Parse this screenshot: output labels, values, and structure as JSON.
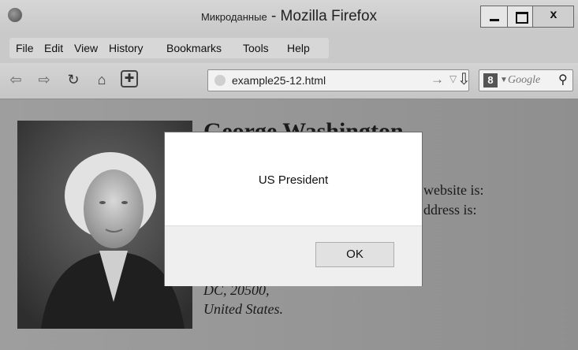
{
  "window": {
    "title_sub": "Микроданные",
    "title_main": "- Mozilla Firefox",
    "close_label": "x"
  },
  "menu": {
    "items": [
      "File",
      "Edit",
      "View",
      "History",
      "Bookmarks",
      "Tools",
      "Help"
    ]
  },
  "toolbar": {
    "url": "example25-12.html",
    "search_placeholder": "Google",
    "search_engine_glyph": "8"
  },
  "page": {
    "heading": "George Washington",
    "line_website": "website is:",
    "line_address": "ddress is:",
    "addr_city": "DC, 20500,",
    "addr_country": "United States."
  },
  "dialog": {
    "message": "US President",
    "ok_label": "OK"
  },
  "colors": {
    "content_bg": "#9e9e9e",
    "dialog_bg": "#ffffff",
    "dialog_footer": "#efefef"
  }
}
